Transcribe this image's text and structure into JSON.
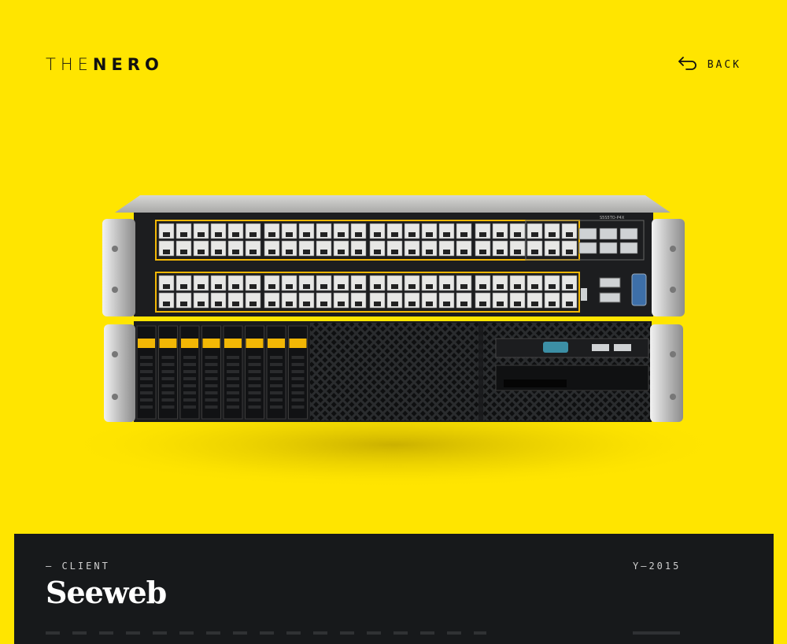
{
  "header": {
    "logo_light": "THE",
    "logo_bold": "NERO",
    "back_label": "BACK"
  },
  "hero": {
    "image_name": "network-switch-and-server-product-render",
    "colors": {
      "background": "#FFE500",
      "accent": "#F2B705",
      "chassis": "#1c1d1f"
    },
    "model_label": "S5S5TO-P4X"
  },
  "project": {
    "client_label": "— CLIENT",
    "client_name": "Seeweb",
    "year_label": "Y—2015"
  },
  "colors": {
    "panel": "#17191b",
    "text_light": "#ffffff",
    "text_muted": "#cfcfcf"
  }
}
